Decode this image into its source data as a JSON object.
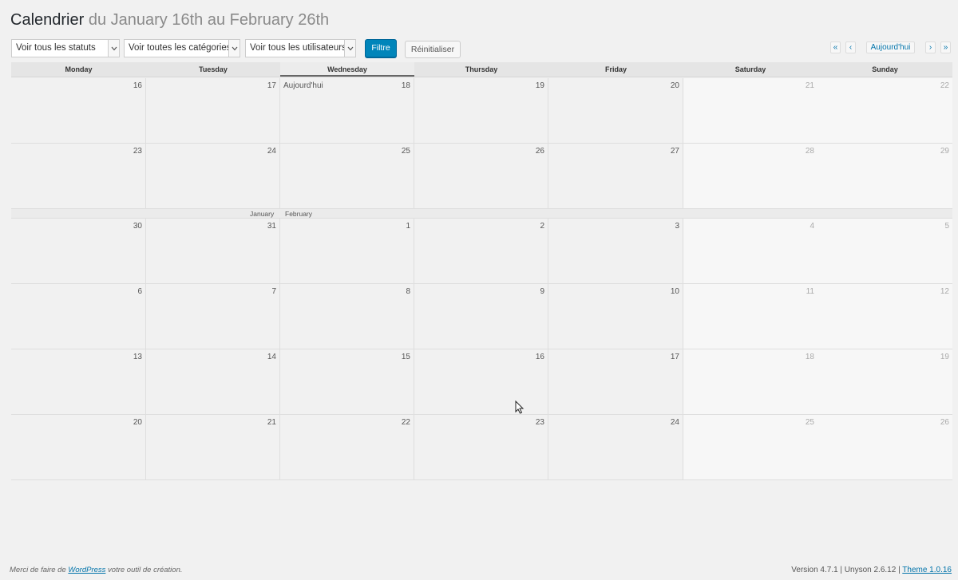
{
  "header": {
    "title": "Calendrier",
    "range": "du January 16th au February 26th"
  },
  "filters": {
    "status": "Voir tous les statuts",
    "categories": "Voir toutes les catégories",
    "users": "Voir tous les utilisateurs",
    "filter_button": "Filtre",
    "reset_button": "Réinitialiser"
  },
  "nav": {
    "first": "«",
    "prev": "‹",
    "today": "Aujourd'hui",
    "next": "›",
    "last": "»"
  },
  "days": [
    "Monday",
    "Tuesday",
    "Wednesday",
    "Thursday",
    "Friday",
    "Saturday",
    "Sunday"
  ],
  "today_label": "Aujourd'hui",
  "weeks": [
    [
      "16",
      "17",
      "18",
      "19",
      "20",
      "21",
      "22"
    ],
    [
      "23",
      "24",
      "25",
      "26",
      "27",
      "28",
      "29"
    ],
    [
      "30",
      "31",
      "1",
      "2",
      "3",
      "4",
      "5"
    ],
    [
      "6",
      "7",
      "8",
      "9",
      "10",
      "11",
      "12"
    ],
    [
      "13",
      "14",
      "15",
      "16",
      "17",
      "18",
      "19"
    ],
    [
      "20",
      "21",
      "22",
      "23",
      "24",
      "25",
      "26"
    ]
  ],
  "month_divider": {
    "prev_month": "January",
    "next_month": "February"
  },
  "footer": {
    "thanks_prefix": "Merci de faire de ",
    "wordpress": "WordPress",
    "thanks_suffix": " votre outil de création.",
    "version": "Version 4.7.1 | Unyson 2.6.12 | ",
    "theme": "Theme 1.0.16"
  },
  "icons": {
    "select_arrow": "chevron-down-icon",
    "cursor": "mouse-pointer-icon"
  },
  "colors": {
    "primary": "#0085ba",
    "link": "#0073aa"
  }
}
